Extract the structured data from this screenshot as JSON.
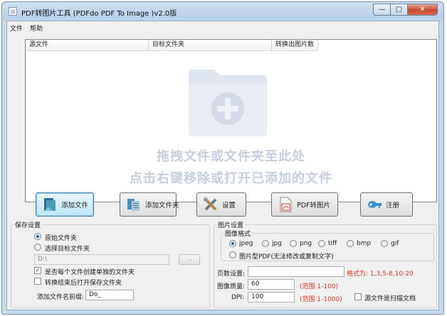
{
  "window": {
    "title": "PDF转图片工具 (PDFdo PDF To Image )v2.0版",
    "min_glyph": "—",
    "max_glyph": "□",
    "close_glyph": "✕"
  },
  "menu": [
    "文件",
    "帮助"
  ],
  "list": {
    "columns": [
      "源文件",
      "目标文件夹",
      "转换出图片数"
    ],
    "hint_line1": "拖拽文件或文件夹至此处",
    "hint_line2": "点击右键移除或打开已添加的文件"
  },
  "buttons": {
    "add_file": "添加文件",
    "add_folder": "添加文件夹",
    "settings": "设置",
    "convert": "PDF转图片",
    "register": "注册"
  },
  "save_settings": {
    "title": "保存设置",
    "radio_original": "原始文件夹",
    "radio_target": "选择目标文件夹",
    "path_value": "D:\\",
    "browse_label": "...",
    "check_per_file": "是否每个文件创建单独的文件夹",
    "check_open_after": "转换结束后打开保存文件夹",
    "prefix_label": "添加文件名前缀:",
    "prefix_value": "Do_"
  },
  "image_settings": {
    "title": "图片设置",
    "format_title": "图像格式",
    "formats": [
      "jpeg",
      "jpg",
      "png",
      "tiff",
      "bmp",
      "gif"
    ],
    "pdf_image_option": "图片型PDF(无法修改或复制文字)",
    "pages_label": "页数设置:",
    "pages_value": "",
    "pages_format": "格式为: 1,3,5-8,10-20",
    "quality_label": "图像质量:",
    "quality_value": "60",
    "quality_range": "(范围 1-100)",
    "dpi_label": "DPI:",
    "dpi_value": "100",
    "dpi_range": "(范围 1-1000)",
    "scan_label": "源文件是扫描文档"
  },
  "colors": {
    "accent_red": "#d23a2d",
    "hint_text": "#c7cfdd"
  }
}
